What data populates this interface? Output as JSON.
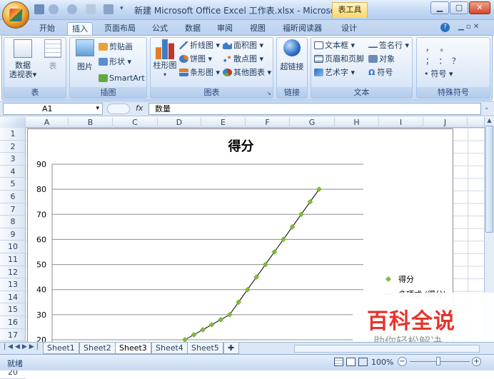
{
  "window": {
    "title": "新建 Microsoft Office Excel 工作表.xlsx - Microsoft ...",
    "context_tab": "表工具",
    "controls": {
      "minimize": "▁",
      "maximize": "▢",
      "close": "✕"
    }
  },
  "tabs": [
    "开始",
    "插入",
    "页面布局",
    "公式",
    "数据",
    "审阅",
    "视图",
    "福昕阅读器",
    "设计"
  ],
  "active_tab": "插入",
  "ribbon": {
    "tables": {
      "caption": "表",
      "pivot": "数据\n透视表▾",
      "table": "表"
    },
    "illustrations": {
      "caption": "插图",
      "picture": "图片",
      "clipart": "剪贴画",
      "shapes": "形状 ▾",
      "smartart": "SmartArt"
    },
    "charts": {
      "caption": "图表",
      "column": "柱形图",
      "line": "折线图 ▾",
      "pie": "饼图 ▾",
      "bar": "条形图 ▾",
      "area": "面积图 ▾",
      "scatter": "散点图 ▾",
      "other": "其他图表 ▾"
    },
    "links": {
      "caption": "链接",
      "hyperlink": "超链接"
    },
    "text": {
      "caption": "文本",
      "textbox": "文本框 ▾",
      "header_footer": "页眉和页脚",
      "wordart": "艺术字 ▾",
      "signature": "签名行 ▾",
      "object": "对象",
      "symbol": "符号"
    },
    "special": {
      "caption": "特殊符号",
      "row1": "，  。",
      "row2": "；  ：  ？",
      "symbol": "符号 ▾"
    }
  },
  "formula_bar": {
    "cell_ref": "A1",
    "fx": "fx",
    "content": "数量"
  },
  "columns": [
    "A",
    "B",
    "C",
    "D",
    "E",
    "F",
    "G",
    "H",
    "I",
    "J"
  ],
  "rows": [
    "1",
    "2",
    "3",
    "4",
    "5",
    "6",
    "7",
    "8",
    "9",
    "10",
    "11",
    "12",
    "13",
    "14",
    "15",
    "16",
    "17",
    "18",
    "19",
    "20"
  ],
  "chart_data": {
    "type": "scatter",
    "title": "得分",
    "xlabel": "",
    "ylabel": "",
    "ylim": [
      20,
      90
    ],
    "yticks": [
      20,
      30,
      40,
      50,
      60,
      70,
      80,
      90
    ],
    "grid": true,
    "legend_position": "right",
    "series": [
      {
        "name": "得分",
        "color": "#7fba3c",
        "marker": "diamond",
        "x": [
          1,
          2,
          3,
          4,
          5,
          6,
          7,
          8,
          9,
          10,
          11,
          12,
          13,
          14,
          15,
          16
        ],
        "y": [
          20,
          22,
          24,
          26,
          28,
          30,
          35,
          40,
          45,
          50,
          55,
          60,
          65,
          70,
          75,
          80
        ]
      },
      {
        "name": "多项式 (得分)",
        "color": "#000000",
        "marker": "line"
      }
    ]
  },
  "sheets": [
    "Sheet1",
    "Sheet2",
    "Sheet3",
    "Sheet4",
    "Sheet5"
  ],
  "active_sheet": "Sheet3",
  "status": {
    "ready": "就绪",
    "zoom": "100%"
  },
  "watermark": {
    "title": "百科全说",
    "subtitle": "助你轻松解决"
  }
}
